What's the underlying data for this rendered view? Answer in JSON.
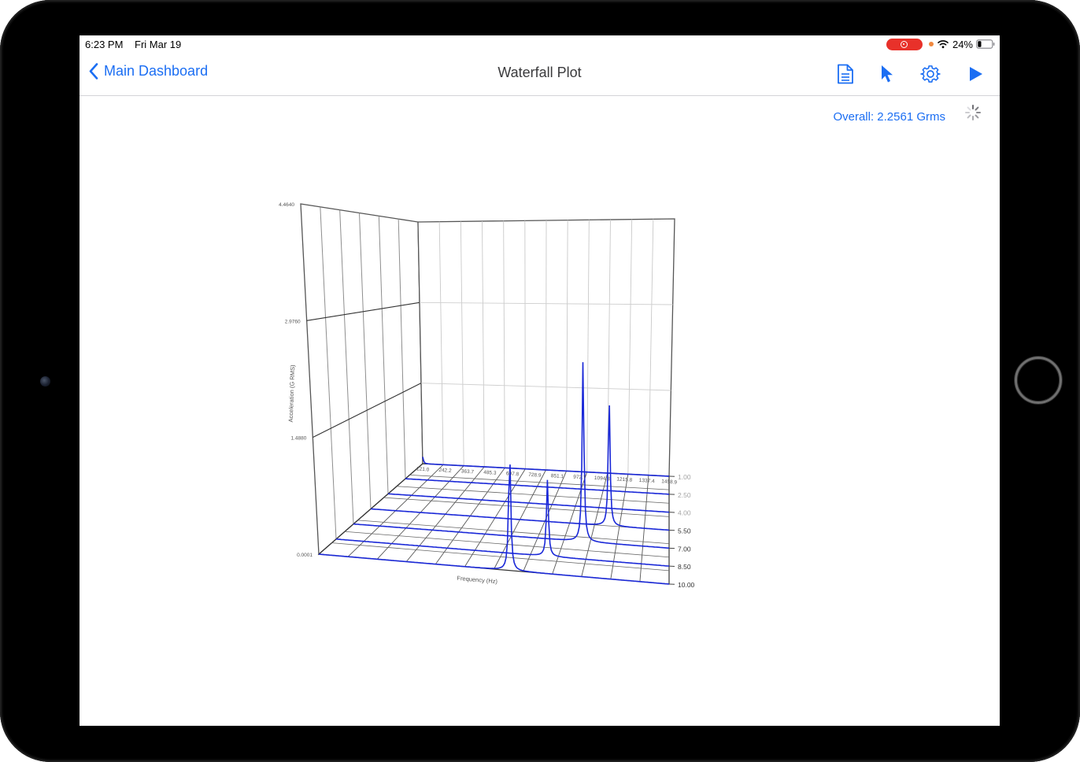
{
  "status_bar": {
    "time": "6:23 PM",
    "date": "Fri Mar 19",
    "battery": "24%",
    "battery_level": 0.24
  },
  "nav": {
    "back_label": "Main Dashboard",
    "title": "Waterfall Plot",
    "actions": [
      "document-icon",
      "pointer-icon",
      "gear-icon",
      "play-icon"
    ]
  },
  "overall": "Overall: 2.2561 Grms",
  "colors": {
    "accent": "#1b6ef3",
    "series": "#1a28d8",
    "record": "#e8312a"
  },
  "chart_data": {
    "type": "waterfall",
    "xlabel": "Frequency (Hz)",
    "ylabel": "Acceleration (G RMS)",
    "ylim": [
      0.0,
      4.464
    ],
    "y_ticks": [
      "0.0001",
      "1.4880",
      "2.9760",
      "4.4640"
    ],
    "x_ticks": [
      "121.0",
      "242.2",
      "363.7",
      "485.3",
      "607.8",
      "728.9",
      "851.1",
      "972.7",
      "1094.3",
      "1215.8",
      "1337.4",
      "1458.9"
    ],
    "z_ticks": [
      "1.00",
      "2.50",
      "4.00",
      "5.50",
      "7.00",
      "8.50",
      "10.00"
    ],
    "z_ticks_legible": [
      false,
      false,
      false,
      true,
      true,
      true,
      true
    ],
    "traces_z": [
      1.0,
      2.5,
      4.0,
      5.5,
      7.0,
      8.5,
      10.0
    ],
    "peaks": [
      {
        "freq": 850,
        "amplitude": 2.12,
        "z": 10.0
      },
      {
        "freq": 970,
        "amplitude": 1.35,
        "z": 8.5
      },
      {
        "freq": 1094,
        "amplitude": 3.2,
        "z": 7.0
      },
      {
        "freq": 1190,
        "amplitude": 2.3,
        "z": 5.5
      },
      {
        "freq": 121,
        "amplitude": 0.12,
        "z": 1.0
      }
    ]
  }
}
